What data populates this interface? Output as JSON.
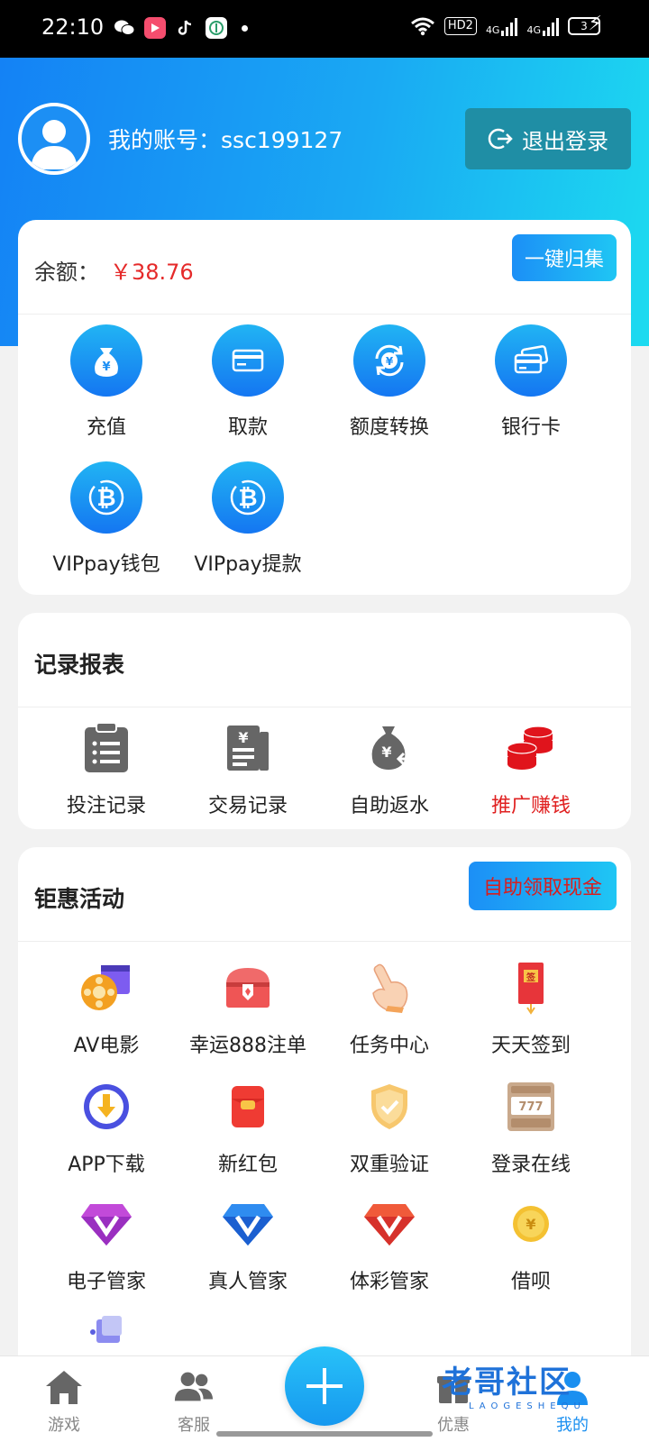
{
  "status_bar": {
    "time": "22:10",
    "hd_label": "HD2",
    "network_1": "4G",
    "network_2": "4G",
    "battery": "3"
  },
  "header": {
    "account_label": "我的账号：",
    "account_id": "ssc199127",
    "logout_label": "退出登录"
  },
  "wallet": {
    "balance_label": "余额：",
    "balance_value": "￥38.76",
    "collect_label": "一键归集",
    "actions": [
      {
        "label": "充值",
        "icon": "money-bag-icon"
      },
      {
        "label": "取款",
        "icon": "card-icon"
      },
      {
        "label": "额度转换",
        "icon": "exchange-icon"
      },
      {
        "label": "银行卡",
        "icon": "bank-card-icon"
      },
      {
        "label": "VIPpay钱包",
        "icon": "bitcoin-icon"
      },
      {
        "label": "VIPpay提款",
        "icon": "bitcoin-icon"
      }
    ]
  },
  "records": {
    "title": "记录报表",
    "items": [
      {
        "label": "投注记录",
        "icon": "clipboard-icon"
      },
      {
        "label": "交易记录",
        "icon": "receipt-icon"
      },
      {
        "label": "自助返水",
        "icon": "money-return-icon"
      },
      {
        "label": "推广赚钱",
        "icon": "coin-stack-icon"
      }
    ]
  },
  "promotions": {
    "title": "钜惠活动",
    "cash_button": "自助领取现金",
    "items": [
      {
        "label": "AV电影",
        "icon": "film-icon"
      },
      {
        "label": "幸运888注单",
        "icon": "treasure-chest-icon"
      },
      {
        "label": "任务中心",
        "icon": "hand-pointer-icon"
      },
      {
        "label": "天天签到",
        "icon": "red-envelope-icon"
      },
      {
        "label": "APP下载",
        "icon": "download-icon"
      },
      {
        "label": "新红包",
        "icon": "red-packet-icon"
      },
      {
        "label": "双重验证",
        "icon": "shield-icon"
      },
      {
        "label": "登录在线",
        "icon": "slot-machine-icon"
      },
      {
        "label": "电子管家",
        "icon": "purple-diamond-icon"
      },
      {
        "label": "真人管家",
        "icon": "blue-diamond-icon"
      },
      {
        "label": "体彩管家",
        "icon": "red-diamond-icon"
      },
      {
        "label": "借呗",
        "icon": "gold-coin-icon"
      }
    ]
  },
  "bottom_nav": {
    "items": [
      {
        "label": "游戏",
        "icon": "home-icon"
      },
      {
        "label": "客服",
        "icon": "users-icon"
      },
      {
        "label": "优惠",
        "icon": "gift-icon"
      },
      {
        "label": "我的",
        "icon": "profile-icon"
      }
    ],
    "active_index": 3
  },
  "watermark": {
    "text": "老哥社区",
    "sub": "LAOGESHEQU"
  },
  "colors": {
    "primary": "#1a8ff0",
    "balance": "#e52a2a",
    "accent_red": "#e02020"
  }
}
